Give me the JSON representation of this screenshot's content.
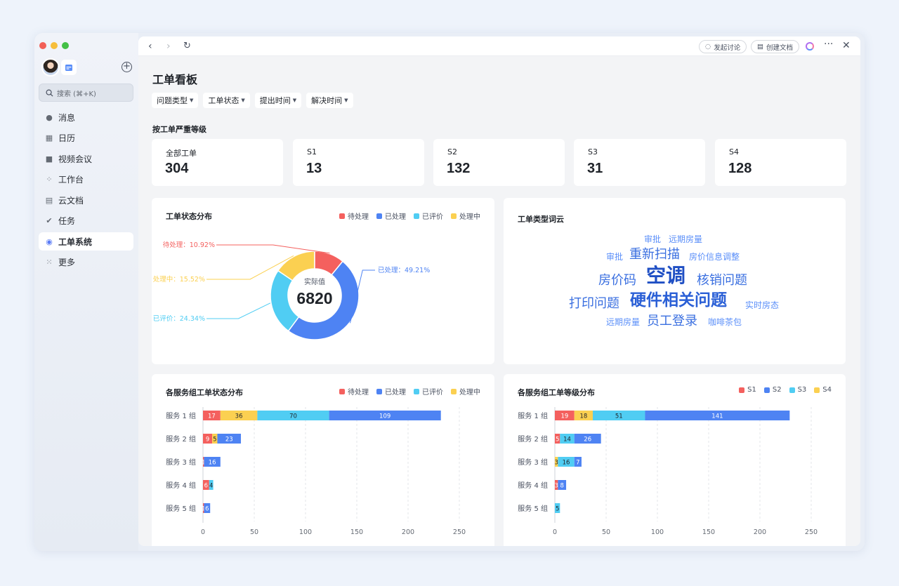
{
  "sidebar": {
    "search_placeholder": "搜索 (⌘+K)",
    "items": [
      {
        "label": "消息",
        "icon": "chat-bubble-icon"
      },
      {
        "label": "日历",
        "icon": "calendar-icon"
      },
      {
        "label": "视频会议",
        "icon": "video-icon"
      },
      {
        "label": "工作台",
        "icon": "grid-icon"
      },
      {
        "label": "云文档",
        "icon": "document-icon"
      },
      {
        "label": "任务",
        "icon": "check-icon"
      },
      {
        "label": "工单系统",
        "icon": "app-icon"
      },
      {
        "label": "更多",
        "icon": "more-grid-icon"
      }
    ]
  },
  "toolbar": {
    "discuss_label": "发起讨论",
    "create_doc_label": "创建文档"
  },
  "page": {
    "title": "工单看板",
    "filters": [
      "问题类型",
      "工单状态",
      "提出时间",
      "解决时间"
    ],
    "severity_section": "按工单严重等级",
    "kpis": [
      {
        "label": "全部工单",
        "value": "304"
      },
      {
        "label": "S1",
        "value": "13"
      },
      {
        "label": "S2",
        "value": "132"
      },
      {
        "label": "S3",
        "value": "31"
      },
      {
        "label": "S4",
        "value": "128"
      }
    ]
  },
  "colors": {
    "pending": "#f4605e",
    "done": "#4e83f3",
    "rated": "#50cdf3",
    "inprogress": "#fbd051",
    "s1": "#f4605e",
    "s2": "#4e83f3",
    "s3": "#50cdf3",
    "s4": "#fbd051"
  },
  "chart_data": [
    {
      "type": "pie",
      "title": "工单状态分布",
      "legend": [
        "待处理",
        "已处理",
        "已评价",
        "处理中"
      ],
      "center_label": "实际值",
      "center_value": "6820",
      "slices": [
        {
          "name": "待处理",
          "value": 10.92,
          "label": "待处理：10.92%"
        },
        {
          "name": "已处理",
          "value": 49.21,
          "label": "已处理：49.21%"
        },
        {
          "name": "已评价",
          "value": 24.34,
          "label": "已评价：24.34%"
        },
        {
          "name": "处理中",
          "value": 15.52,
          "label": "处理中：15.52%"
        }
      ]
    },
    {
      "type": "bar",
      "title": "各服务组工单状态分布",
      "orientation": "horizontal",
      "stacked": true,
      "categories": [
        "服务 1 组",
        "服务 2 组",
        "服务 3 组",
        "服务 4 组",
        "服务 5 组"
      ],
      "series": [
        {
          "name": "待处理",
          "values": [
            17,
            9,
            1,
            6,
            1
          ]
        },
        {
          "name": "处理中",
          "values": [
            36,
            5,
            0,
            0,
            0
          ]
        },
        {
          "name": "已评价",
          "values": [
            70,
            0,
            0,
            4,
            0
          ]
        },
        {
          "name": "已处理",
          "values": [
            109,
            23,
            16,
            0,
            6
          ]
        }
      ],
      "legend": [
        "待处理",
        "已处理",
        "已评价",
        "处理中"
      ],
      "xlim": [
        0,
        250
      ],
      "xticks": [
        "0",
        "50",
        "100",
        "150",
        "200",
        "250"
      ]
    },
    {
      "type": "bar",
      "title": "各服务组工单等级分布",
      "orientation": "horizontal",
      "stacked": true,
      "categories": [
        "服务 1 组",
        "服务 2 组",
        "服务 3 组",
        "服务 4 组",
        "服务 5 组"
      ],
      "series": [
        {
          "name": "S1",
          "values": [
            19,
            5,
            0,
            3,
            0
          ]
        },
        {
          "name": "S4",
          "values": [
            18,
            0,
            3,
            0,
            0
          ]
        },
        {
          "name": "S3",
          "values": [
            51,
            14,
            16,
            0,
            5
          ]
        },
        {
          "name": "S2",
          "values": [
            141,
            26,
            7,
            8,
            0
          ]
        }
      ],
      "legend": [
        "S1",
        "S2",
        "S3",
        "S4"
      ],
      "xlim": [
        0,
        250
      ],
      "xticks": [
        "0",
        "50",
        "100",
        "150",
        "200",
        "250"
      ]
    }
  ],
  "word_cloud": {
    "title": "工单类型词云",
    "words": [
      {
        "text": "审批",
        "weight": 1
      },
      {
        "text": "远期房量",
        "weight": 1
      },
      {
        "text": "审批",
        "weight": 1
      },
      {
        "text": "重新扫描",
        "weight": 3
      },
      {
        "text": "房价信息调整",
        "weight": 1
      },
      {
        "text": "房价码",
        "weight": 3
      },
      {
        "text": "空调",
        "weight": 5
      },
      {
        "text": "核销问题",
        "weight": 3
      },
      {
        "text": "打印问题",
        "weight": 3
      },
      {
        "text": "硬件相关问题",
        "weight": 4
      },
      {
        "text": "实时房态",
        "weight": 1
      },
      {
        "text": "远期房量",
        "weight": 1
      },
      {
        "text": "员工登录",
        "weight": 3
      },
      {
        "text": "咖啡茶包",
        "weight": 1
      }
    ]
  }
}
